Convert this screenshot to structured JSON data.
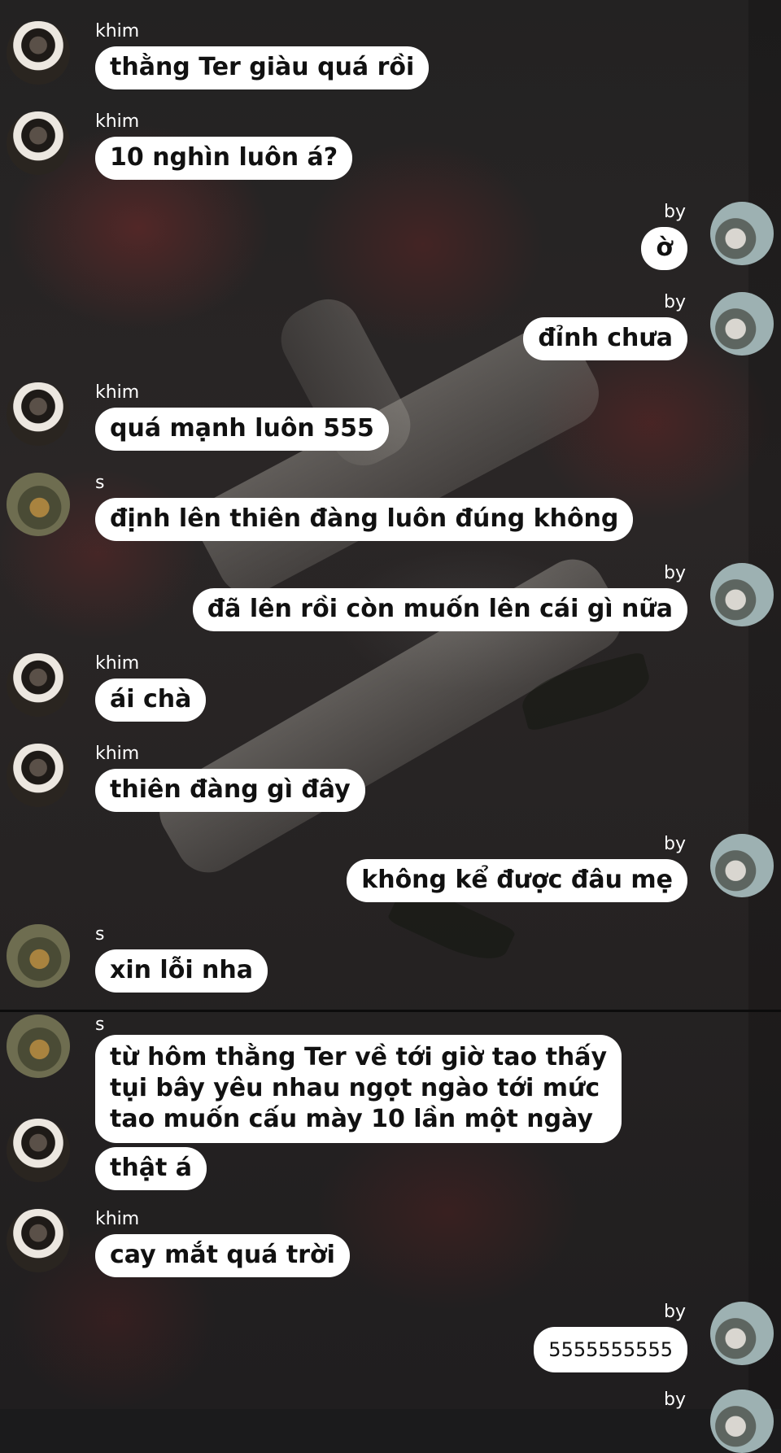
{
  "messages": [
    {
      "side": "left",
      "sender": "khim",
      "text": "thằng Ter giàu quá rồi"
    },
    {
      "side": "left",
      "sender": "khim",
      "text": "10 nghìn luôn á?"
    },
    {
      "side": "right",
      "sender": "by",
      "text": "ờ"
    },
    {
      "side": "right",
      "sender": "by",
      "text": "đỉnh chưa"
    },
    {
      "side": "left",
      "sender": "khim",
      "text": "quá mạnh luôn 555"
    },
    {
      "side": "left",
      "sender": "s",
      "text": "định lên thiên đàng luôn đúng không"
    },
    {
      "side": "right",
      "sender": "by",
      "text": "đã lên rồi còn muốn lên cái gì nữa"
    },
    {
      "side": "left",
      "sender": "khim",
      "text": "ái chà"
    },
    {
      "side": "left",
      "sender": "khim",
      "text": "thiên đàng gì đây"
    },
    {
      "side": "right",
      "sender": "by",
      "text": "không kể được đâu mẹ"
    },
    {
      "side": "left",
      "sender": "s",
      "text": "xin lỗi nha"
    },
    {
      "side": "left",
      "sender": "s",
      "text": "từ hôm thằng Ter về tới giờ tao thấy\ntụi bây yêu nhau ngọt ngào tới mức\ntao muốn cấu mày 10 lần một ngày"
    },
    {
      "side": "left",
      "sender": "khim",
      "text": "thật á"
    },
    {
      "side": "left",
      "sender": "khim",
      "text": "cay mắt quá trời"
    },
    {
      "side": "right",
      "sender": "by",
      "text": "5555555555"
    },
    {
      "side": "right",
      "sender": "by",
      "text": ""
    }
  ]
}
